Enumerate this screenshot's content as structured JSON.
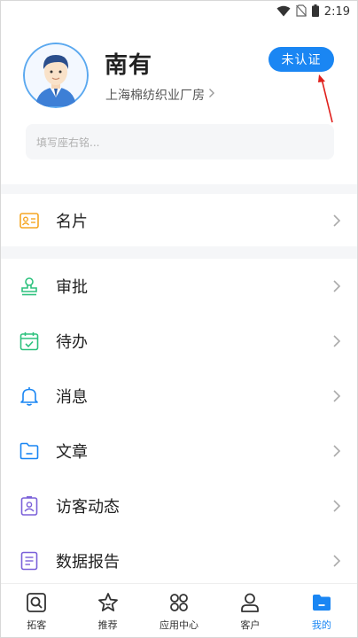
{
  "status_bar": {
    "time": "2:19",
    "icons": [
      "wifi-icon",
      "no-sim-icon",
      "battery-icon"
    ]
  },
  "profile": {
    "name": "南有",
    "company": "上海棉纺织业厂房",
    "verify_label": "未认证",
    "motto_placeholder": "填写座右铭..."
  },
  "menu": [
    {
      "label": "名片",
      "icon": "business-card-icon"
    },
    {
      "label": "审批",
      "icon": "stamp-icon"
    },
    {
      "label": "待办",
      "icon": "calendar-check-icon"
    },
    {
      "label": "消息",
      "icon": "bell-icon"
    },
    {
      "label": "文章",
      "icon": "folder-icon"
    },
    {
      "label": "访客动态",
      "icon": "visitor-badge-icon"
    },
    {
      "label": "数据报告",
      "icon": "report-icon"
    }
  ],
  "tabbar": [
    {
      "label": "拓客",
      "icon": "prospect-icon",
      "active": false
    },
    {
      "label": "推荐",
      "icon": "star-icon",
      "active": false
    },
    {
      "label": "应用中心",
      "icon": "apps-grid-icon",
      "active": false
    },
    {
      "label": "客户",
      "icon": "person-icon",
      "active": false
    },
    {
      "label": "我的",
      "icon": "folder-icon",
      "active": true
    }
  ],
  "colors": {
    "accent": "#1a86f3",
    "card_orange": "#f5a623",
    "green": "#2ec27e",
    "purple": "#7b61d9",
    "annotation": "#e0201c"
  }
}
